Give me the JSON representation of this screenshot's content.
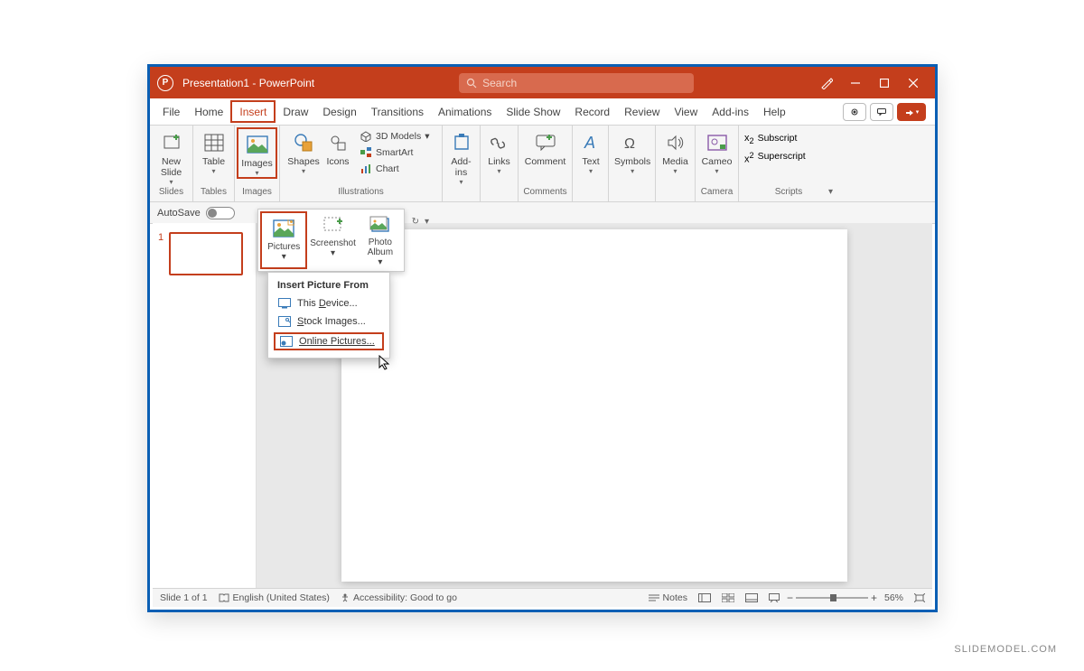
{
  "titlebar": {
    "app_icon_letter": "P",
    "title": "Presentation1 - PowerPoint",
    "search_placeholder": "Search"
  },
  "tabs": {
    "file": "File",
    "home": "Home",
    "insert": "Insert",
    "draw": "Draw",
    "design": "Design",
    "transitions": "Transitions",
    "animations": "Animations",
    "slideshow": "Slide Show",
    "record": "Record",
    "review": "Review",
    "view": "View",
    "addins": "Add-ins",
    "help": "Help"
  },
  "ribbon": {
    "slides": {
      "new_slide": "New\nSlide",
      "group": "Slides"
    },
    "tables": {
      "table": "Table",
      "group": "Tables"
    },
    "images": {
      "images": "Images",
      "group": "Images"
    },
    "illustrations": {
      "shapes": "Shapes",
      "icons": "Icons",
      "models": "3D Models",
      "smartart": "SmartArt",
      "chart": "Chart",
      "group": "Illustrations"
    },
    "addins": {
      "label": "Add-\nins",
      "group": ""
    },
    "links": {
      "label": "Links",
      "group": ""
    },
    "comment": {
      "label": "Comment",
      "group": "Comments"
    },
    "text": {
      "label": "Text",
      "group": ""
    },
    "symbols": {
      "label": "Symbols",
      "group": ""
    },
    "media": {
      "label": "Media",
      "group": ""
    },
    "cameo": {
      "label": "Cameo",
      "group": "Camera"
    },
    "scripts": {
      "sub": "Subscript",
      "sup": "Superscript",
      "group": "Scripts"
    }
  },
  "autosave": {
    "label": "AutoSave",
    "state": "Off"
  },
  "pictures_panel": {
    "pictures": "Pictures",
    "screenshot": "Screenshot",
    "album": "Photo\nAlbum"
  },
  "insert_from": {
    "header": "Insert Picture From",
    "this_device": "This Device...",
    "stock": "Stock Images...",
    "online": "Online Pictures..."
  },
  "thumb": {
    "num": "1"
  },
  "statusbar": {
    "slide": "Slide 1 of 1",
    "lang": "English (United States)",
    "access": "Accessibility: Good to go",
    "notes": "Notes",
    "zoom": "56%"
  },
  "watermark": "SLIDEMODEL.COM"
}
